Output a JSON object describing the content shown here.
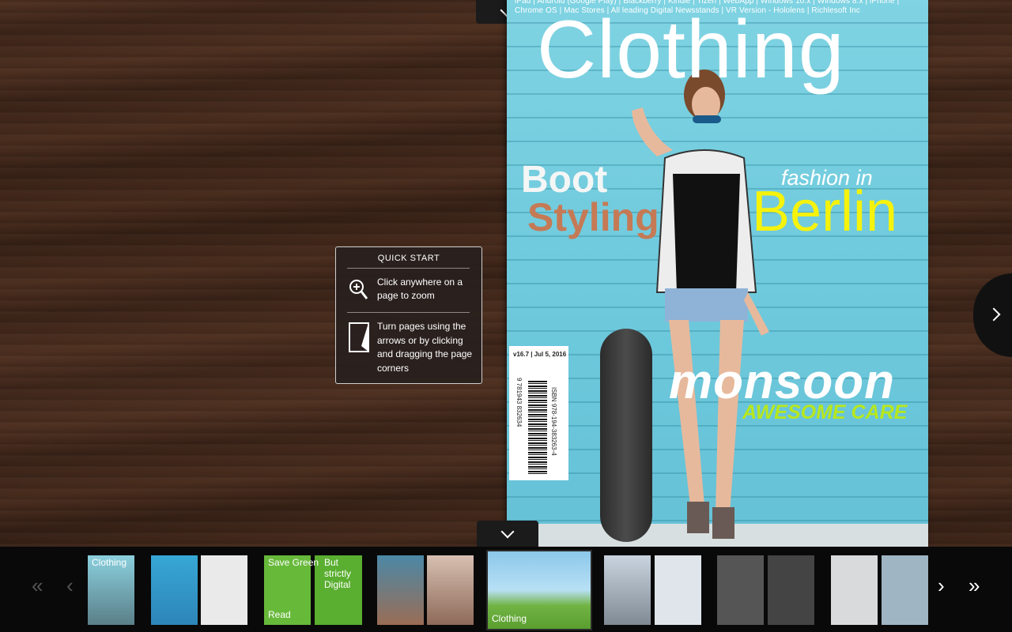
{
  "magazine": {
    "fine_print": "iPad | Android (Google Play) | Blackberry | Kindle | Tizen | WebApp | Windows 10.x | Windows 8.x | iPhone | Chrome OS | Mac Stores | All leading Digital Newsstands | VR Version - Hololens | Richlesoft Inc",
    "title": "Clothing",
    "headline1": "Boot",
    "headline2": "Styling",
    "headline3": "fashion in",
    "headline4": "Berlin",
    "headline5": "monsoon",
    "headline6": "AWESOME CARE",
    "issue": "v16.7 | Jul 5, 2016",
    "isbn": "ISBN 978-194-383263-4",
    "barcode_number": "9 781943 832634"
  },
  "quick_start": {
    "title": "QUICK START",
    "zoom_tip": "Click anywhere on a page to zoom",
    "turn_tip": "Turn pages using the arrows or by clicking and dragging the page corners"
  },
  "thumbnails": [
    {
      "label": "Clothing",
      "label2": "",
      "color_a": "#8bd0de",
      "color_b": "#5a7f88"
    },
    {
      "label": "",
      "label2": "",
      "color_a": "#37a7d6",
      "color_b": "#eaeaea"
    },
    {
      "label": "Save Green",
      "label2": "Read",
      "color_a": "#67b93a",
      "color_b": "#5aae30"
    },
    {
      "label": "But strictly Digital",
      "label2": "",
      "color_a": "#5aae30",
      "color_b": "#5aae30"
    },
    {
      "label": "",
      "label2": "",
      "color_a": "#4b88a6",
      "color_b": "#d7c0b2"
    },
    {
      "label": "",
      "label2": "Clothing",
      "color_a": "#8cc7ea",
      "color_b": "#71b444"
    },
    {
      "label": "",
      "label2": "",
      "color_a": "#c9d4df",
      "color_b": "#dfe5ea"
    },
    {
      "label": "",
      "label2": "",
      "color_a": "#555555",
      "color_b": "#444444"
    },
    {
      "label": "",
      "label2": "",
      "color_a": "#d8dadb",
      "color_b": "#9fb5c4"
    }
  ],
  "nav": {
    "first": "«",
    "prev": "‹",
    "next": "›",
    "last": "»"
  }
}
